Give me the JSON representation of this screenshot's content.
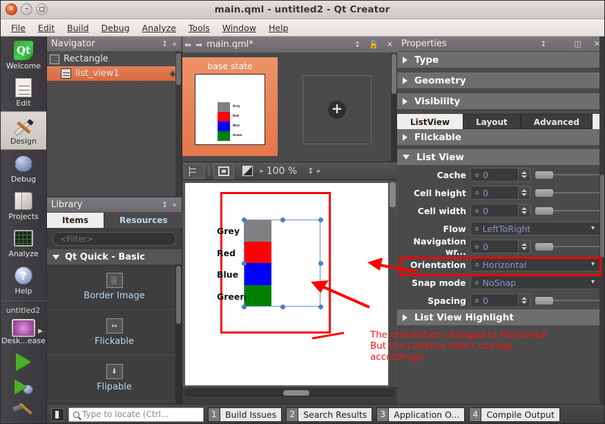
{
  "window": {
    "title": "main.qml - untitled2 - Qt Creator",
    "close_glyph": "×",
    "minimize_glyph": "–",
    "maximize_glyph": ""
  },
  "menubar": {
    "items": [
      "File",
      "Edit",
      "Build",
      "Debug",
      "Analyze",
      "Tools",
      "Window",
      "Help"
    ]
  },
  "modebar": {
    "items": [
      {
        "label": "Welcome",
        "icon": "qt-logo-icon",
        "active": false
      },
      {
        "label": "Edit",
        "icon": "edit-document-icon",
        "active": false
      },
      {
        "label": "Design",
        "icon": "design-brush-ruler-icon",
        "active": true
      },
      {
        "label": "Debug",
        "icon": "debug-bug-icon",
        "active": false
      },
      {
        "label": "Projects",
        "icon": "projects-folder-icon",
        "active": false
      },
      {
        "label": "Analyze",
        "icon": "analyze-monitor-icon",
        "active": false
      },
      {
        "label": "Help",
        "icon": "help-question-icon",
        "active": false
      }
    ],
    "kit": {
      "project_name": "untitled2",
      "target_label": "Desk...ease",
      "icon": "kit-monitor-icon",
      "expand_arrow": "▶"
    },
    "run_button": "run-green-triangle-icon",
    "debug_button": "run-debug-icon",
    "build_button": "build-hammer-icon"
  },
  "navigator": {
    "title": "Navigator",
    "sort_icon": "sort-updown-icon",
    "more_icon": "chevron-double-right-icon",
    "rows": [
      {
        "label": "Rectangle",
        "icon": "rectangle-icon",
        "selected": false,
        "eye": ""
      },
      {
        "label": "list_view1",
        "icon": "listview-icon",
        "selected": true,
        "eye": "◉"
      }
    ]
  },
  "library": {
    "title": "Library",
    "sort_icon": "sort-updown-icon",
    "more_icon": "chevron-double-right-icon",
    "tabs": [
      {
        "label": "Items",
        "active": true
      },
      {
        "label": "Resources",
        "active": false
      }
    ],
    "filter_placeholder": "<Filter>",
    "filter_value": "",
    "section": "Qt Quick - Basic",
    "items": [
      {
        "label": "Border Image",
        "icon": "border-image-icon",
        "glyph": "░"
      },
      {
        "label": "Flickable",
        "icon": "flickable-icon",
        "glyph": "↔"
      },
      {
        "label": "Flipable",
        "icon": "flipable-icon",
        "glyph": "⬇"
      }
    ]
  },
  "editor": {
    "back_icon": "arrow-left-icon",
    "forward_icon": "arrow-right-icon",
    "filename": "main.qml*",
    "split_icon": "split-updown-icon",
    "lock_icon": "unlocked-padlock-icon",
    "close_icon": "close-x-icon"
  },
  "states": {
    "base_label": "base state",
    "add_state_icon": "plus-circle-icon",
    "thumbnail_items": [
      {
        "label": "Grey",
        "color": "#808080"
      },
      {
        "label": "Red",
        "color": "#ff0000"
      },
      {
        "label": "Blue",
        "color": "#0000ff"
      },
      {
        "label": "Green",
        "color": "#008000"
      }
    ]
  },
  "canvas_toolbar": {
    "align_icon": "reset-view-icon",
    "frame_icon": "show-boundaries-icon",
    "contrast_icon": "toggle-background-icon",
    "overflow_icon": "chevron-double-right-icon",
    "zoom_level": "100 %",
    "zoom_spin_icon": "spin-updown-icon",
    "more_icon": "chevron-double-right-icon"
  },
  "canvas": {
    "list_items": [
      {
        "label": "Grey",
        "color": "#808080"
      },
      {
        "label": "Red",
        "color": "#ff0000"
      },
      {
        "label": "Blue",
        "color": "#0000ff"
      },
      {
        "label": "Green",
        "color": "#008000"
      }
    ],
    "selection_color": "#4a7fc1",
    "highlight_color": "#fc0000"
  },
  "annotation": {
    "color": "#ff1313",
    "line1": "The orientation changed to Horizental",
    "line2": "But the ListView didn't change",
    "line3": "accordingly."
  },
  "properties": {
    "title": "Properties",
    "sort_icon": "sort-updown-icon",
    "dock_icon": "dock-split-icon",
    "close_icon": "close-x-icon",
    "top_sections": [
      {
        "label": "Type",
        "expanded": false
      },
      {
        "label": "Geometry",
        "expanded": false
      },
      {
        "label": "Visibility",
        "expanded": false
      }
    ],
    "tabs": [
      {
        "label": "ListView",
        "active": true
      },
      {
        "label": "Layout",
        "active": false
      },
      {
        "label": "Advanced",
        "active": false
      }
    ],
    "flickable_section": {
      "label": "Flickable",
      "expanded": false
    },
    "listview_section": {
      "label": "List View",
      "expanded": true
    },
    "fields": [
      {
        "label": "Cache",
        "value": "0",
        "kind": "number",
        "slider": true,
        "highlighted": false
      },
      {
        "label": "Cell height",
        "value": "0",
        "kind": "number",
        "slider": true,
        "highlighted": false
      },
      {
        "label": "Cell width",
        "value": "0",
        "kind": "number",
        "slider": true,
        "highlighted": false
      },
      {
        "label": "Flow",
        "value": "LeftToRight",
        "kind": "combo",
        "slider": false,
        "highlighted": false
      },
      {
        "label": "Navigation wr...",
        "value": "0",
        "kind": "number",
        "slider": true,
        "highlighted": false
      },
      {
        "label": "Orientation",
        "value": "Horizontal",
        "kind": "combo",
        "slider": false,
        "highlighted": true
      },
      {
        "label": "Snap mode",
        "value": "NoSnap",
        "kind": "combo",
        "slider": false,
        "highlighted": false
      },
      {
        "label": "Spacing",
        "value": "0",
        "kind": "number",
        "slider": true,
        "highlighted": false
      }
    ],
    "highlight_section": {
      "label": "List View Highlight",
      "expanded": false
    }
  },
  "statusbar": {
    "sidebar_toggle_icon": "toggle-sidebar-icon",
    "locate_icon": "search-icon",
    "locate_placeholder": "Type to locate (Ctrl...",
    "locate_value": "",
    "outputs": [
      {
        "num": "1",
        "label": "Build Issues"
      },
      {
        "num": "2",
        "label": "Search Results"
      },
      {
        "num": "3",
        "label": "Application O..."
      },
      {
        "num": "4",
        "label": "Compile Output"
      }
    ]
  }
}
